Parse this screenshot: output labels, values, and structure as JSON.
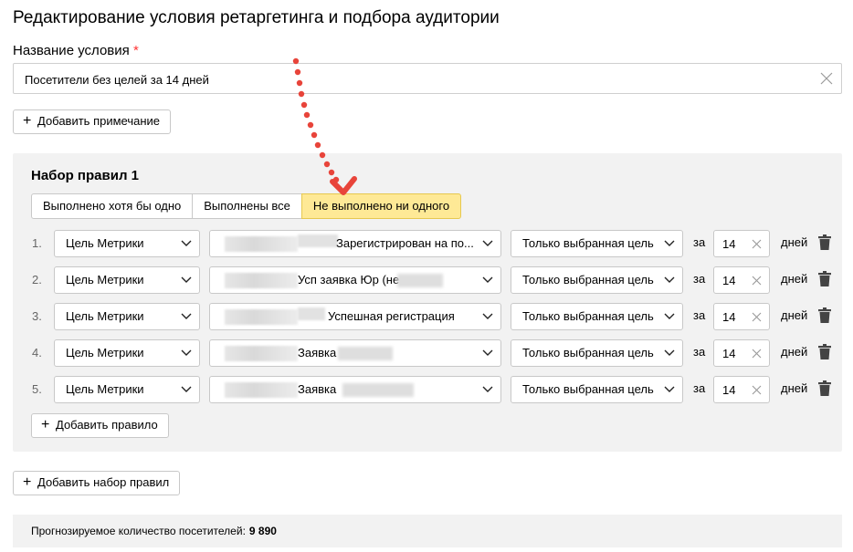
{
  "page": {
    "title": "Редактирование условия ретаргетинга и подбора аудитории"
  },
  "condition_name": {
    "label": "Название условия",
    "required_mark": "*",
    "value": "Посетители без целей за 14 дней"
  },
  "add_note_label": "Добавить примечание",
  "ruleset": {
    "title": "Набор правил 1",
    "modes": [
      {
        "label": "Выполнено хотя бы одно",
        "active": false
      },
      {
        "label": "Выполнены все",
        "active": false
      },
      {
        "label": "Не выполнено ни одного",
        "active": true
      }
    ],
    "rules": [
      {
        "num": "1.",
        "type": "Цель Метрики",
        "goal": "Зарегистрирован на по...",
        "scope": "Только выбранная цель",
        "za": "за",
        "days": "14",
        "days_label": "дней"
      },
      {
        "num": "2.",
        "type": "Цель Метрики",
        "goal": "Усп заявка Юр (не",
        "scope": "Только выбранная цель",
        "za": "за",
        "days": "14",
        "days_label": "дней"
      },
      {
        "num": "3.",
        "type": "Цель Метрики",
        "goal": "Успешная регистрация",
        "scope": "Только выбранная цель",
        "za": "за",
        "days": "14",
        "days_label": "дней"
      },
      {
        "num": "4.",
        "type": "Цель Метрики",
        "goal": "Заявка",
        "scope": "Только выбранная цель",
        "za": "за",
        "days": "14",
        "days_label": "дней"
      },
      {
        "num": "5.",
        "type": "Цель Метрики",
        "goal": "Заявка",
        "scope": "Только выбранная цель",
        "za": "за",
        "days": "14",
        "days_label": "дней"
      }
    ],
    "add_rule_label": "Добавить правило"
  },
  "add_ruleset_label": "Добавить набор правил",
  "forecast": {
    "label": "Прогнозируемое количество посетителей:",
    "value": "9 890"
  },
  "colors": {
    "active_mode_bg": "#fee996",
    "panel_bg": "#f2f2f2",
    "annotation_arrow": "#e8443a",
    "required": "#ff3333"
  },
  "icons": {
    "clear": "close-icon",
    "dropdown": "chevron-down-icon",
    "delete": "trash-icon",
    "add": "plus-icon"
  }
}
